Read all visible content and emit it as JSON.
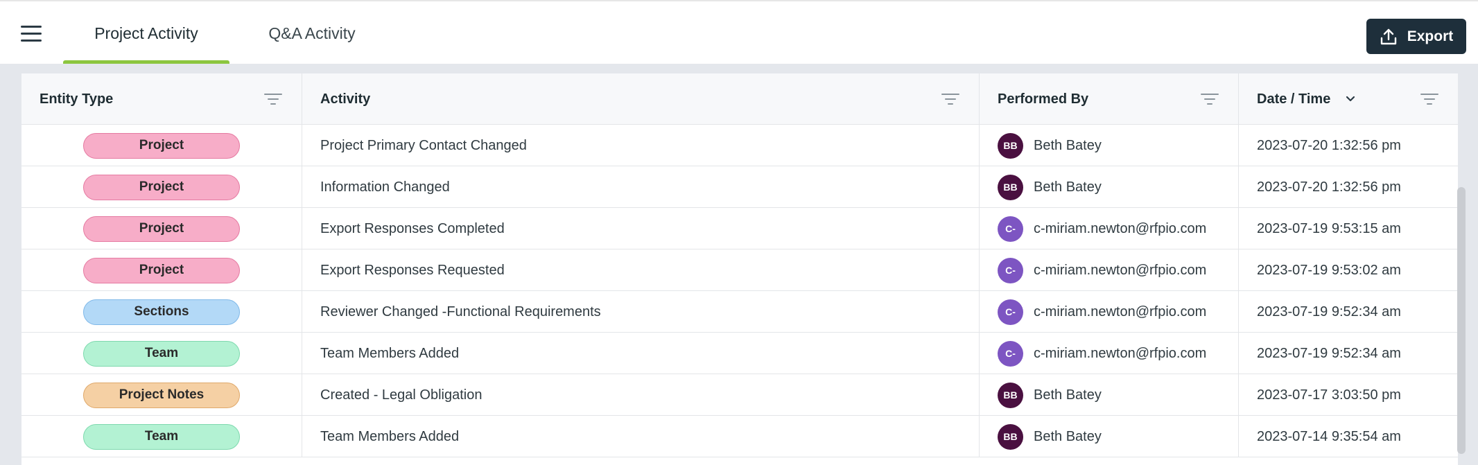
{
  "tabs": [
    {
      "label": "Project Activity",
      "active": true
    },
    {
      "label": "Q&A Activity",
      "active": false
    }
  ],
  "export": {
    "label": "Export",
    "icon": "upload-icon"
  },
  "colors": {
    "accent": "#8cc63f",
    "export_bg": "#1e2f3b",
    "entity": {
      "Project": {
        "bg": "#f7adc8",
        "border": "#e57aa1"
      },
      "Sections": {
        "bg": "#b3d9f7",
        "border": "#7fb8e8"
      },
      "Team": {
        "bg": "#b3f2d3",
        "border": "#7ed9ae"
      },
      "Project Notes": {
        "bg": "#f5d0a4",
        "border": "#dfa86a"
      }
    },
    "avatar": {
      "BB": "#4a1040",
      "C-": "#7d55c2"
    }
  },
  "columns": {
    "entity_type": "Entity Type",
    "activity": "Activity",
    "performed_by": "Performed By",
    "date_time": "Date / Time"
  },
  "rows": [
    {
      "entity": "Project",
      "activity": "Project Primary Contact Changed",
      "initials": "BB",
      "user": "Beth Batey",
      "datetime": "2023-07-20 1:32:56 pm"
    },
    {
      "entity": "Project",
      "activity": "Information Changed",
      "initials": "BB",
      "user": "Beth Batey",
      "datetime": "2023-07-20 1:32:56 pm"
    },
    {
      "entity": "Project",
      "activity": "Export Responses Completed",
      "initials": "C-",
      "user": "c-miriam.newton@rfpio.com",
      "datetime": "2023-07-19 9:53:15 am"
    },
    {
      "entity": "Project",
      "activity": "Export Responses Requested",
      "initials": "C-",
      "user": "c-miriam.newton@rfpio.com",
      "datetime": "2023-07-19 9:53:02 am"
    },
    {
      "entity": "Sections",
      "activity": "Reviewer Changed -Functional Requirements",
      "initials": "C-",
      "user": "c-miriam.newton@rfpio.com",
      "datetime": "2023-07-19 9:52:34 am"
    },
    {
      "entity": "Team",
      "activity": "Team Members Added",
      "initials": "C-",
      "user": "c-miriam.newton@rfpio.com",
      "datetime": "2023-07-19 9:52:34 am"
    },
    {
      "entity": "Project Notes",
      "activity": "Created - Legal Obligation",
      "initials": "BB",
      "user": "Beth Batey",
      "datetime": "2023-07-17 3:03:50 pm"
    },
    {
      "entity": "Team",
      "activity": "Team Members Added",
      "initials": "BB",
      "user": "Beth Batey",
      "datetime": "2023-07-14 9:35:54 am"
    }
  ]
}
